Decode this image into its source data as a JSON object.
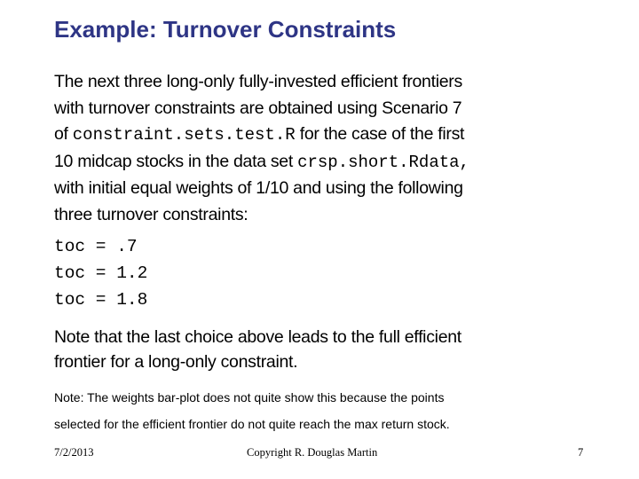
{
  "slide": {
    "title": "Example: Turnover Constraints",
    "intro": {
      "line1": "The next three long-only fully-invested efficient frontiers",
      "line2": "with turnover constraints are obtained using Scenario 7",
      "line3_prefix": "of ",
      "line3_code": "constraint.sets.test.R",
      "line3_suffix": " for the case of the first",
      "line4_prefix": "10 midcap stocks in the data set ",
      "line4_code": "crsp.short.Rdata,",
      "line5": "with initial equal weights of 1/10 and using the following",
      "line6": "three turnover constraints:"
    },
    "constraints": [
      "toc = .7",
      "toc = 1.2",
      "toc = 1.8"
    ],
    "note_main": {
      "line1": "Note that the last choice above leads to the full efficient",
      "line2": "frontier for a long-only constraint."
    },
    "note_small": {
      "line1": "Note:  The weights bar-plot does not quite show this because the points",
      "line2": "selected for the efficient frontier do not quite reach the max return stock."
    },
    "footer": {
      "date": "7/2/2013",
      "copyright": "Copyright R. Douglas Martin",
      "page_number": "7"
    }
  }
}
